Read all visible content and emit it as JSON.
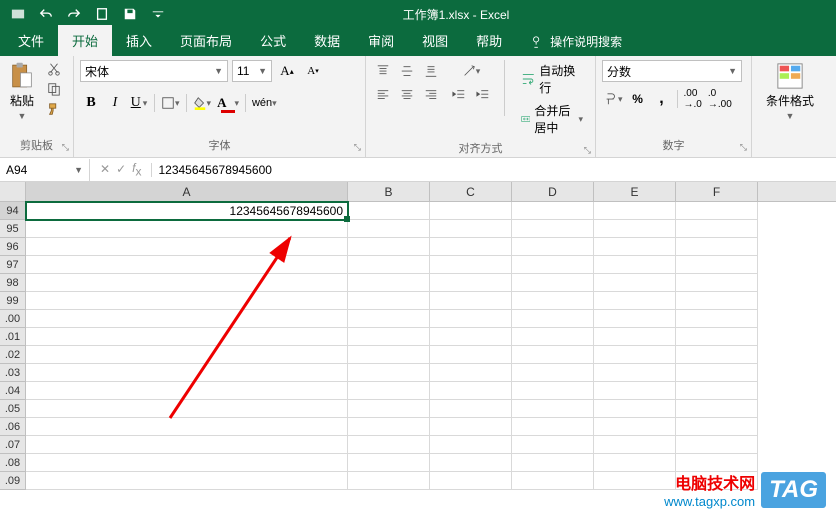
{
  "title": "工作簿1.xlsx - Excel",
  "tabs": {
    "file": "文件",
    "home": "开始",
    "insert": "插入",
    "layout": "页面布局",
    "formula": "公式",
    "data": "数据",
    "review": "审阅",
    "view": "视图",
    "help": "帮助",
    "tellme": "操作说明搜索"
  },
  "ribbon": {
    "clipboard": {
      "label": "剪贴板",
      "paste": "粘贴"
    },
    "font": {
      "label": "字体",
      "name": "宋体",
      "size": "11"
    },
    "align": {
      "label": "对齐方式",
      "wrap": "自动换行",
      "merge": "合并后居中"
    },
    "number": {
      "label": "数字",
      "format": "分数"
    },
    "styles": {
      "cond": "条件格式"
    }
  },
  "namebox": "A94",
  "formula_value": "12345645678945600",
  "columns": [
    "A",
    "B",
    "C",
    "D",
    "E",
    "F"
  ],
  "rows": [
    "94",
    "95",
    "96",
    "97",
    "98",
    "99",
    ".00",
    ".01",
    ".02",
    ".03",
    ".04",
    ".05",
    ".06",
    ".07",
    ".08",
    ".09"
  ],
  "cell_value": "12345645678945600",
  "watermark": {
    "line1": "电脑技术网",
    "line2": "www.tagxp.com",
    "tag": "TAG"
  }
}
